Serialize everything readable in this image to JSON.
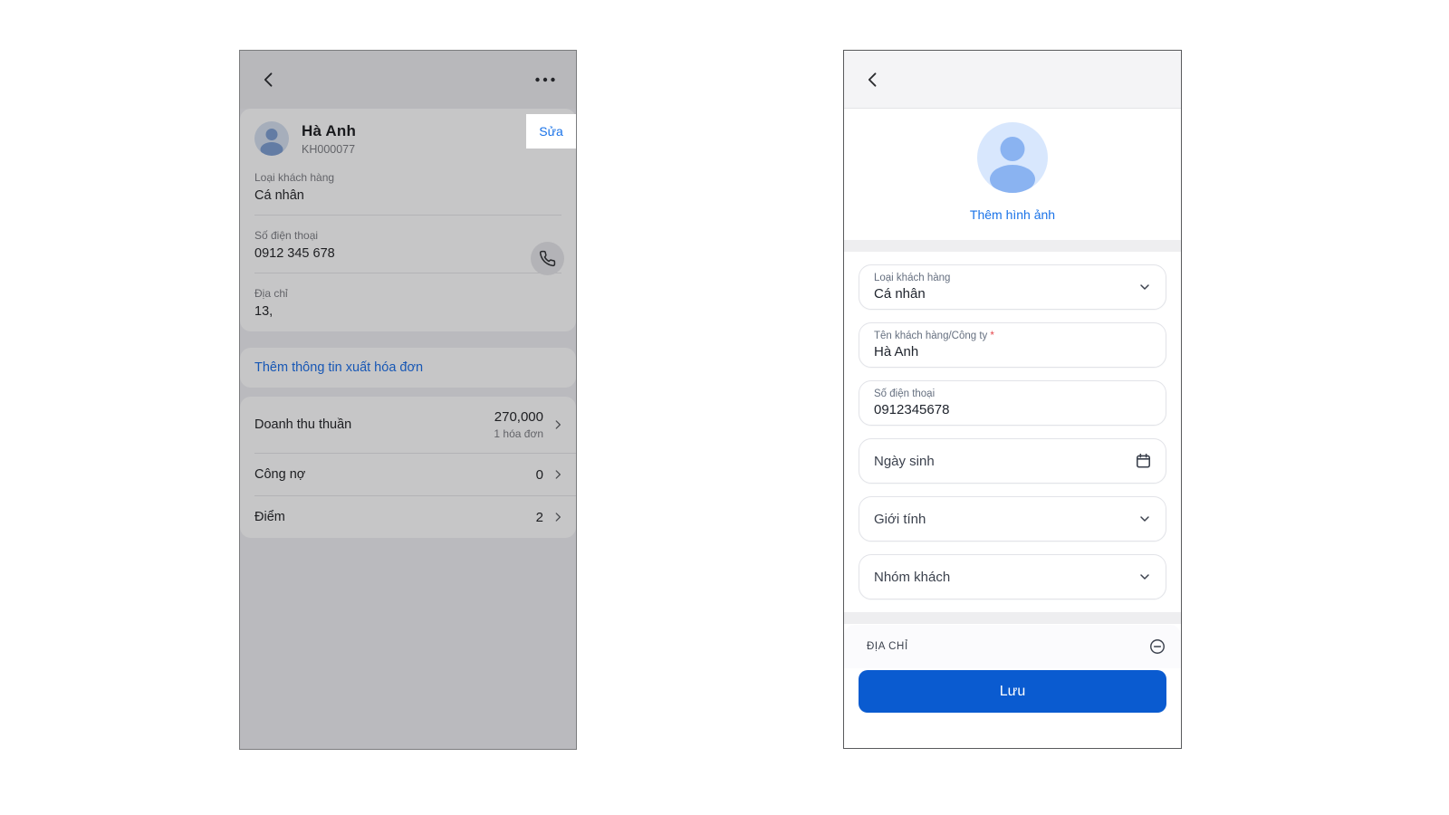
{
  "colors": {
    "accent_blue": "#1a73e8",
    "save_blue": "#0a5bd0",
    "required_red": "#e5484d"
  },
  "icons": {
    "back": "chevron-left",
    "more": "more-dots",
    "call": "phone",
    "open": "chevron-right",
    "expand": "chevron-down",
    "date": "calendar",
    "collapse": "minus-circle",
    "avatar": "person"
  },
  "left_screen": {
    "profile": {
      "name": "Hà Anh",
      "code": "KH000077",
      "edit_label": "Sửa",
      "fields": [
        {
          "label": "Loại khách hàng",
          "value": "Cá nhân"
        },
        {
          "label": "Số điện thoại",
          "value": "0912 345 678",
          "action_icon": "phone"
        },
        {
          "label": "Địa chỉ",
          "value": "13,"
        }
      ]
    },
    "invoice_link": "Thêm thông tin xuất hóa đơn",
    "stats": [
      {
        "label": "Doanh thu thuần",
        "value": "270,000",
        "sub": "1 hóa đơn"
      },
      {
        "label": "Công nợ",
        "value": "0"
      },
      {
        "label": "Điểm",
        "value": "2"
      }
    ]
  },
  "right_screen": {
    "photo_prompt": "Thêm hình ảnh",
    "required_mark": "*",
    "form": [
      {
        "label": "Loại khách hàng",
        "value": "Cá nhân",
        "trailing": "chevron-down"
      },
      {
        "label": "Tên khách hàng/Công ty",
        "value": "Hà Anh",
        "required": true
      },
      {
        "label": "Số điện thoại",
        "value": "0912345678"
      },
      {
        "placeholder": "Ngày sinh",
        "trailing": "calendar"
      },
      {
        "placeholder": "Giới tính",
        "trailing": "chevron-down"
      },
      {
        "placeholder": "Nhóm khách",
        "trailing": "chevron-down"
      }
    ],
    "address_section_label": "ĐỊA CHỈ",
    "save_label": "Lưu"
  }
}
